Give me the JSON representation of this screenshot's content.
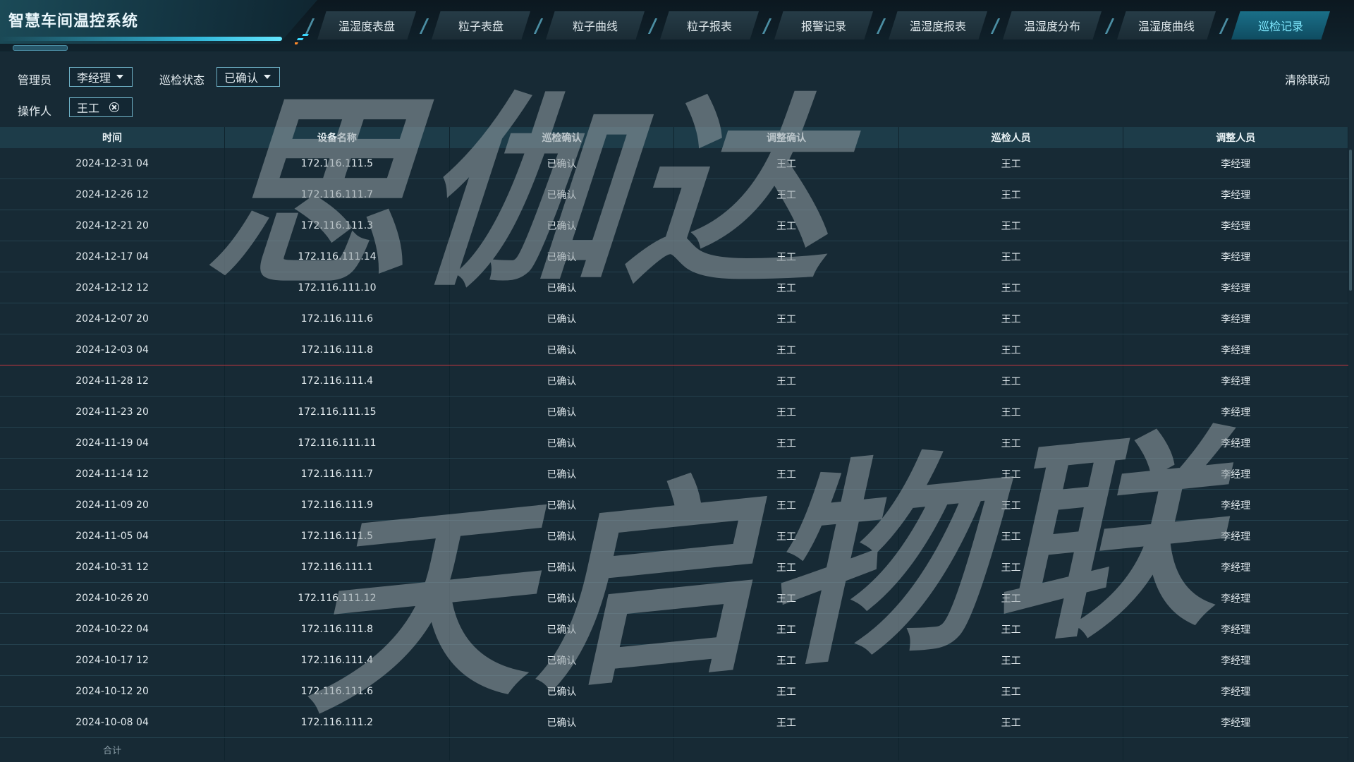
{
  "app": {
    "title": "智慧车间温控系统"
  },
  "tabs": [
    {
      "label": "温湿度表盘",
      "active": false
    },
    {
      "label": "粒子表盘",
      "active": false
    },
    {
      "label": "粒子曲线",
      "active": false
    },
    {
      "label": "粒子报表",
      "active": false
    },
    {
      "label": "报警记录",
      "active": false
    },
    {
      "label": "温湿度报表",
      "active": false
    },
    {
      "label": "温湿度分布",
      "active": false
    },
    {
      "label": "温湿度曲线",
      "active": false
    },
    {
      "label": "巡检记录",
      "active": true
    }
  ],
  "filters": {
    "admin_label": "管理员",
    "admin_value": "李经理",
    "status_label": "巡检状态",
    "status_value": "已确认",
    "operator_label": "操作人",
    "operator_value": "王工",
    "clear_label": "清除联动"
  },
  "table": {
    "columns": [
      "时间",
      "设备名称",
      "巡检确认",
      "调整确认",
      "巡检人员",
      "调整人员"
    ],
    "rows": [
      [
        "2024-12-31 04",
        "172.116.111.5",
        "已确认",
        "王工",
        "王工",
        "李经理"
      ],
      [
        "2024-12-26 12",
        "172.116.111.7",
        "已确认",
        "王工",
        "王工",
        "李经理"
      ],
      [
        "2024-12-21 20",
        "172.116.111.3",
        "已确认",
        "王工",
        "王工",
        "李经理"
      ],
      [
        "2024-12-17 04",
        "172.116.111.14",
        "已确认",
        "王工",
        "王工",
        "李经理"
      ],
      [
        "2024-12-12 12",
        "172.116.111.10",
        "已确认",
        "王工",
        "王工",
        "李经理"
      ],
      [
        "2024-12-07 20",
        "172.116.111.6",
        "已确认",
        "王工",
        "王工",
        "李经理"
      ],
      [
        "2024-12-03 04",
        "172.116.111.8",
        "已确认",
        "王工",
        "王工",
        "李经理"
      ],
      [
        "2024-11-28 12",
        "172.116.111.4",
        "已确认",
        "王工",
        "王工",
        "李经理"
      ],
      [
        "2024-11-23 20",
        "172.116.111.15",
        "已确认",
        "王工",
        "王工",
        "李经理"
      ],
      [
        "2024-11-19 04",
        "172.116.111.11",
        "已确认",
        "王工",
        "王工",
        "李经理"
      ],
      [
        "2024-11-14 12",
        "172.116.111.7",
        "已确认",
        "王工",
        "王工",
        "李经理"
      ],
      [
        "2024-11-09 20",
        "172.116.111.9",
        "已确认",
        "王工",
        "王工",
        "李经理"
      ],
      [
        "2024-11-05 04",
        "172.116.111.5",
        "已确认",
        "王工",
        "王工",
        "李经理"
      ],
      [
        "2024-10-31 12",
        "172.116.111.1",
        "已确认",
        "王工",
        "王工",
        "李经理"
      ],
      [
        "2024-10-26 20",
        "172.116.111.12",
        "已确认",
        "王工",
        "王工",
        "李经理"
      ],
      [
        "2024-10-22 04",
        "172.116.111.8",
        "已确认",
        "王工",
        "王工",
        "李经理"
      ],
      [
        "2024-10-17 12",
        "172.116.111.4",
        "已确认",
        "王工",
        "王工",
        "李经理"
      ],
      [
        "2024-10-12 20",
        "172.116.111.6",
        "已确认",
        "王工",
        "王工",
        "李经理"
      ],
      [
        "2024-10-08 04",
        "172.116.111.2",
        "已确认",
        "王工",
        "王工",
        "李经理"
      ]
    ],
    "footer_label": "合计"
  },
  "watermark": {
    "line1": "思伽达",
    "line2": "天启物联"
  },
  "colors": {
    "accent": "#3ad8ff",
    "highlight_line": "#c9363f",
    "background": "#172a35"
  }
}
